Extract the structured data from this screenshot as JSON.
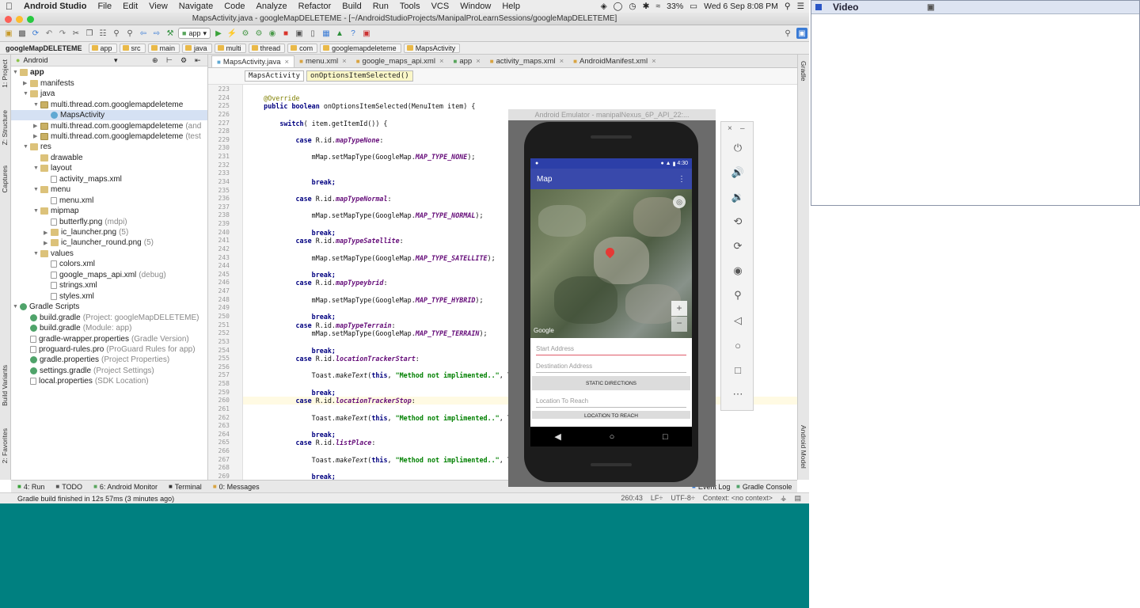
{
  "menubar": {
    "app_name": "Android Studio",
    "items": [
      "File",
      "Edit",
      "View",
      "Navigate",
      "Code",
      "Analyze",
      "Refactor",
      "Build",
      "Run",
      "Tools",
      "VCS",
      "Window",
      "Help"
    ],
    "battery": "33%",
    "clock": "Wed 6 Sep  8:08 PM"
  },
  "window_title": "MapsActivity.java - googleMapDELETEME - [~/AndroidStudioProjects/ManipalProLearnSessions/googleMapDELETEME]",
  "toolbar": {
    "run_config": "app"
  },
  "breadcrumbs": [
    "googleMapDELETEME",
    "app",
    "src",
    "main",
    "java",
    "multi",
    "thread",
    "com",
    "googlemapdeleteme",
    "MapsActivity"
  ],
  "left_strip": {
    "project": "1: Project",
    "structure": "Z: Structure",
    "captures": "Captures",
    "build_variants": "Build Variants",
    "favorites": "2: Favorites"
  },
  "right_strip": {
    "gradle": "Gradle",
    "android_model": "Android Model"
  },
  "project_panel": {
    "view_mode": "Android",
    "tree": [
      {
        "label": "app",
        "depth": 0,
        "type": "folder",
        "arrow": "down",
        "bold": true
      },
      {
        "label": "manifests",
        "depth": 1,
        "type": "folder",
        "arrow": "right"
      },
      {
        "label": "java",
        "depth": 1,
        "type": "folder",
        "arrow": "down"
      },
      {
        "label": "multi.thread.com.googlemapdeleteme",
        "depth": 2,
        "type": "pkg",
        "arrow": "down"
      },
      {
        "label": "MapsActivity",
        "depth": 3,
        "type": "java",
        "arrow": "",
        "selected": true
      },
      {
        "label": "multi.thread.com.googlemapdeleteme",
        "hint": "(and",
        "depth": 2,
        "type": "pkg",
        "arrow": "right"
      },
      {
        "label": "multi.thread.com.googlemapdeleteme",
        "hint": "(test",
        "depth": 2,
        "type": "pkg",
        "arrow": "right"
      },
      {
        "label": "res",
        "depth": 1,
        "type": "folder",
        "arrow": "down"
      },
      {
        "label": "drawable",
        "depth": 2,
        "type": "folder",
        "arrow": ""
      },
      {
        "label": "layout",
        "depth": 2,
        "type": "folder",
        "arrow": "down"
      },
      {
        "label": "activity_maps.xml",
        "depth": 3,
        "type": "file",
        "arrow": ""
      },
      {
        "label": "menu",
        "depth": 2,
        "type": "folder",
        "arrow": "down"
      },
      {
        "label": "menu.xml",
        "depth": 3,
        "type": "file",
        "arrow": ""
      },
      {
        "label": "mipmap",
        "depth": 2,
        "type": "folder",
        "arrow": "down"
      },
      {
        "label": "butterfly.png",
        "hint": "(mdpi)",
        "depth": 3,
        "type": "file",
        "arrow": ""
      },
      {
        "label": "ic_launcher.png",
        "hint": "(5)",
        "depth": 3,
        "type": "folder",
        "arrow": "right"
      },
      {
        "label": "ic_launcher_round.png",
        "hint": "(5)",
        "depth": 3,
        "type": "folder",
        "arrow": "right"
      },
      {
        "label": "values",
        "depth": 2,
        "type": "folder",
        "arrow": "down"
      },
      {
        "label": "colors.xml",
        "depth": 3,
        "type": "file",
        "arrow": ""
      },
      {
        "label": "google_maps_api.xml",
        "hint": "(debug)",
        "depth": 3,
        "type": "file",
        "arrow": ""
      },
      {
        "label": "strings.xml",
        "depth": 3,
        "type": "file",
        "arrow": ""
      },
      {
        "label": "styles.xml",
        "depth": 3,
        "type": "file",
        "arrow": ""
      },
      {
        "label": "Gradle Scripts",
        "depth": 0,
        "type": "gradle",
        "arrow": "down"
      },
      {
        "label": "build.gradle",
        "hint": "(Project: googleMapDELETEME)",
        "depth": 1,
        "type": "gradle",
        "arrow": ""
      },
      {
        "label": "build.gradle",
        "hint": "(Module: app)",
        "depth": 1,
        "type": "gradle",
        "arrow": ""
      },
      {
        "label": "gradle-wrapper.properties",
        "hint": "(Gradle Version)",
        "depth": 1,
        "type": "file",
        "arrow": ""
      },
      {
        "label": "proguard-rules.pro",
        "hint": "(ProGuard Rules for app)",
        "depth": 1,
        "type": "file",
        "arrow": ""
      },
      {
        "label": "gradle.properties",
        "hint": "(Project Properties)",
        "depth": 1,
        "type": "gradle",
        "arrow": ""
      },
      {
        "label": "settings.gradle",
        "hint": "(Project Settings)",
        "depth": 1,
        "type": "gradle",
        "arrow": ""
      },
      {
        "label": "local.properties",
        "hint": "(SDK Location)",
        "depth": 1,
        "type": "file",
        "arrow": ""
      }
    ]
  },
  "editor_tabs": [
    {
      "label": "MapsActivity.java",
      "active": true
    },
    {
      "label": "menu.xml"
    },
    {
      "label": "google_maps_api.xml"
    },
    {
      "label": "app"
    },
    {
      "label": "activity_maps.xml"
    },
    {
      "label": "AndroidManifest.xml"
    }
  ],
  "context_crumbs": [
    "MapsActivity",
    "onOptionsItemSelected()"
  ],
  "code_first_line": 223,
  "current_line": 260,
  "code_lines": [
    [],
    [
      [
        "ann",
        "    @Override"
      ]
    ],
    [
      [
        "kw",
        "    public boolean "
      ],
      [
        "",
        "onOptionsItemSelected(MenuItem item) {"
      ]
    ],
    [],
    [
      [
        "kw",
        "        switch"
      ],
      [
        "",
        "( item.getItemId()) {"
      ]
    ],
    [],
    [
      [
        "kw",
        "            case "
      ],
      [
        "",
        "R.id."
      ],
      [
        "id",
        "mapTypeNone"
      ],
      [
        "",
        ":"
      ]
    ],
    [],
    [
      [
        "",
        "                mMap.setMapType(GoogleMap."
      ],
      [
        "id",
        "MAP_TYPE_NONE"
      ],
      [
        "",
        ");"
      ]
    ],
    [],
    [],
    [
      [
        "kw",
        "                break;"
      ]
    ],
    [],
    [
      [
        "kw",
        "            case "
      ],
      [
        "",
        "R.id."
      ],
      [
        "id",
        "mapTypeNormal"
      ],
      [
        "",
        ":"
      ]
    ],
    [],
    [
      [
        "",
        "                mMap.setMapType(GoogleMap."
      ],
      [
        "id",
        "MAP_TYPE_NORMAL"
      ],
      [
        "",
        ");"
      ]
    ],
    [],
    [
      [
        "kw",
        "                break;"
      ]
    ],
    [
      [
        "kw",
        "            case "
      ],
      [
        "",
        "R.id."
      ],
      [
        "id",
        "mapTypeSatellite"
      ],
      [
        "",
        ":"
      ]
    ],
    [],
    [
      [
        "",
        "                mMap.setMapType(GoogleMap."
      ],
      [
        "id",
        "MAP_TYPE_SATELLITE"
      ],
      [
        "",
        ");"
      ]
    ],
    [],
    [
      [
        "kw",
        "                break;"
      ]
    ],
    [
      [
        "kw",
        "            case "
      ],
      [
        "",
        "R.id."
      ],
      [
        "id",
        "mapTypeybrid"
      ],
      [
        "",
        ":"
      ]
    ],
    [],
    [
      [
        "",
        "                mMap.setMapType(GoogleMap."
      ],
      [
        "id",
        "MAP_TYPE_HYBRID"
      ],
      [
        "",
        ");"
      ]
    ],
    [],
    [
      [
        "kw",
        "                break;"
      ]
    ],
    [
      [
        "kw",
        "            case "
      ],
      [
        "",
        "R.id."
      ],
      [
        "id",
        "mapTypeTerrain"
      ],
      [
        "",
        ":"
      ]
    ],
    [
      [
        "",
        "                mMap.setMapType(GoogleMap."
      ],
      [
        "id",
        "MAP_TYPE_TERRAIN"
      ],
      [
        "",
        ");"
      ]
    ],
    [],
    [
      [
        "kw",
        "                break;"
      ]
    ],
    [
      [
        "kw",
        "            case "
      ],
      [
        "",
        "R.id."
      ],
      [
        "id",
        "locationTrackerStart"
      ],
      [
        "",
        ":"
      ]
    ],
    [],
    [
      [
        "",
        "                Toast."
      ],
      [
        "meth",
        "makeText"
      ],
      [
        "",
        "("
      ],
      [
        "kw",
        "this"
      ],
      [
        "",
        ", "
      ],
      [
        "str",
        "\"Method not implimented..\""
      ],
      [
        "",
        ", To"
      ]
    ],
    [],
    [
      [
        "kw",
        "                break;"
      ]
    ],
    [
      [
        "kw",
        "            case "
      ],
      [
        "",
        "R.id."
      ],
      [
        "id",
        "locationTrackerStop"
      ],
      [
        "",
        ":"
      ]
    ],
    [],
    [
      [
        "",
        "                Toast."
      ],
      [
        "meth",
        "makeText"
      ],
      [
        "",
        "("
      ],
      [
        "kw",
        "this"
      ],
      [
        "",
        ", "
      ],
      [
        "str",
        "\"Method not implimented..\""
      ],
      [
        "",
        ", To"
      ]
    ],
    [],
    [
      [
        "kw",
        "                break;"
      ]
    ],
    [
      [
        "kw",
        "            case "
      ],
      [
        "",
        "R.id."
      ],
      [
        "id",
        "listPlace"
      ],
      [
        "",
        ":"
      ]
    ],
    [],
    [
      [
        "",
        "                Toast."
      ],
      [
        "meth",
        "makeText"
      ],
      [
        "",
        "("
      ],
      [
        "kw",
        "this"
      ],
      [
        "",
        ", "
      ],
      [
        "str",
        "\"Method not implimented..\""
      ],
      [
        "",
        ", To"
      ]
    ],
    [],
    [
      [
        "kw",
        "                break;"
      ]
    ]
  ],
  "bottom_tabs": [
    "4: Run",
    "TODO",
    "6: Android Monitor",
    "Terminal",
    "0: Messages",
    "Event Log",
    "Gradle Console"
  ],
  "status": {
    "message": "Gradle build finished in 12s 57ms (3 minutes ago)",
    "position": "260:43",
    "line_sep": "LF÷",
    "encoding": "UTF-8÷",
    "context": "Context: <no context>"
  },
  "emulator": {
    "title": "Android Emulator - manipalNexus_6P_API_22:...",
    "status_time": "4:30",
    "app_title": "Map",
    "map_brand": "Google",
    "start_placeholder": "Start Address",
    "dest_placeholder": "Destination Address",
    "static_btn": "STATIC DIRECTIONS",
    "reach_placeholder": "Location To Reach",
    "reach_btn": "LOCATION TO REACH"
  },
  "video": {
    "title": "Video"
  },
  "colors": {
    "teal": "#008080",
    "appbar": "#3949ab",
    "marker": "#e53935"
  }
}
